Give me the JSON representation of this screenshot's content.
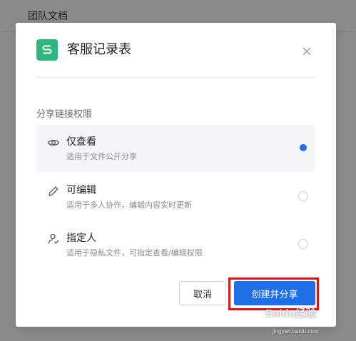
{
  "background": {
    "title": "团队文档"
  },
  "dialog": {
    "title": "客服记录表",
    "app_icon_letter": "S",
    "section_label": "分享链接权限",
    "options": [
      {
        "title": "仅查看",
        "desc": "适用于文件公开分享",
        "icon": "eye-icon",
        "selected": true
      },
      {
        "title": "可编辑",
        "desc": "适用于多人协作，编辑内容实时更新",
        "icon": "pencil-icon",
        "selected": false
      },
      {
        "title": "指定人",
        "desc": "适用于隐私文件，可指定查看/编辑权限",
        "icon": "user-check-icon",
        "selected": false
      }
    ],
    "cancel_label": "取消",
    "create_label": "创建并分享"
  },
  "watermark": {
    "brand": "Baidu经验",
    "url": "jingyan.baidu.com"
  },
  "colors": {
    "accent": "#1f6fe8",
    "app_icon": "#2eb77d",
    "highlight": "#e01515"
  }
}
